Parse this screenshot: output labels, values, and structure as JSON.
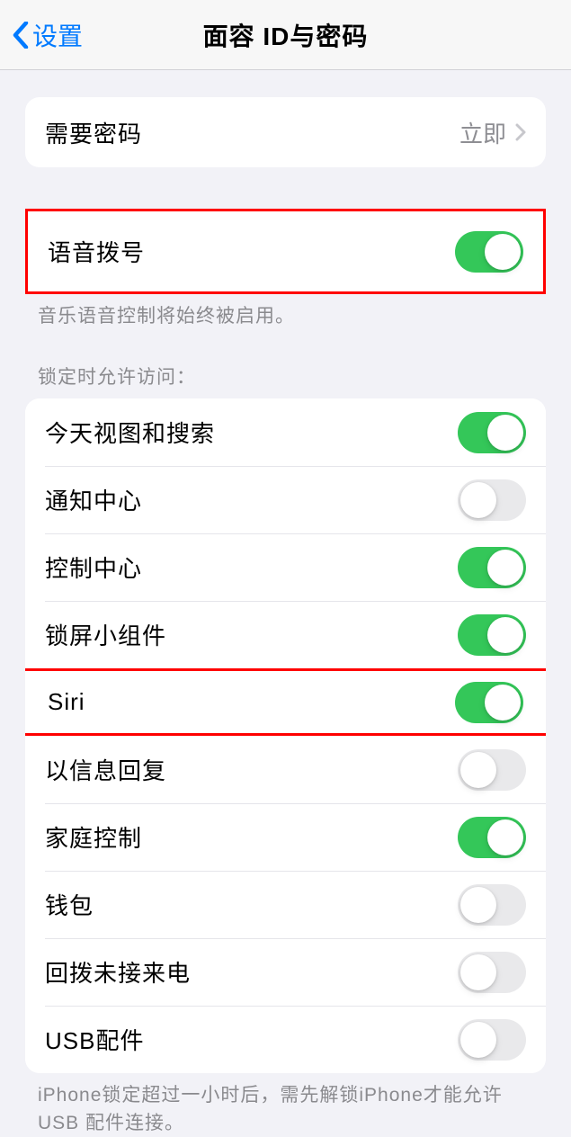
{
  "nav": {
    "back_label": "设置",
    "title": "面容 ID与密码"
  },
  "require_passcode": {
    "label": "需要密码",
    "value": "立即"
  },
  "voice_dial": {
    "label": "语音拨号",
    "enabled": true,
    "footer": "音乐语音控制将始终被启用。"
  },
  "allow_access": {
    "header": "锁定时允许访问：",
    "items": [
      {
        "label": "今天视图和搜索",
        "enabled": true,
        "highlighted": false
      },
      {
        "label": "通知中心",
        "enabled": false,
        "highlighted": false
      },
      {
        "label": "控制中心",
        "enabled": true,
        "highlighted": false
      },
      {
        "label": "锁屏小组件",
        "enabled": true,
        "highlighted": false
      },
      {
        "label": "Siri",
        "enabled": true,
        "highlighted": true
      },
      {
        "label": "以信息回复",
        "enabled": false,
        "highlighted": false
      },
      {
        "label": "家庭控制",
        "enabled": true,
        "highlighted": false
      },
      {
        "label": "钱包",
        "enabled": false,
        "highlighted": false
      },
      {
        "label": "回拨未接来电",
        "enabled": false,
        "highlighted": false
      },
      {
        "label": "USB配件",
        "enabled": false,
        "highlighted": false
      }
    ],
    "footer": "iPhone锁定超过一小时后，需先解锁iPhone才能允许USB 配件连接。"
  }
}
